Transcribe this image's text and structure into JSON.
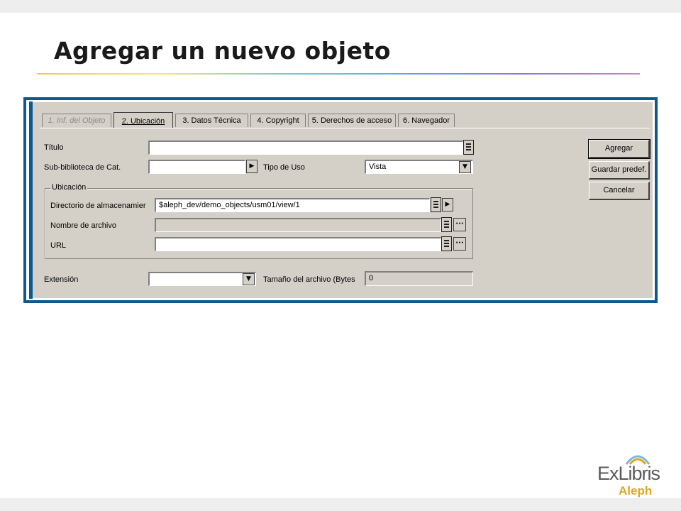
{
  "slide": {
    "title": "Agregar un nuevo objeto"
  },
  "tabs": [
    {
      "label": "1. Inf. del Objeto",
      "state": "disabled"
    },
    {
      "label": "2. Ubicación",
      "state": "active"
    },
    {
      "label": "3. Datos Técnica",
      "state": "normal"
    },
    {
      "label": "4. Copyright",
      "state": "normal"
    },
    {
      "label": "5. Derechos de acceso",
      "state": "normal"
    },
    {
      "label": "6. Navegador",
      "state": "normal"
    }
  ],
  "form": {
    "titulo_label": "Título",
    "titulo_value": "",
    "subbiblioteca_label": "Sub-biblioteca de Cat.",
    "subbiblioteca_value": "",
    "tipo_uso_label": "Tipo de Uso",
    "tipo_uso_value": "Vista",
    "ubicacion_group": "Ubicación",
    "directorio_label": "Directorio de almacenamier",
    "directorio_value": "$aleph_dev/demo_objects/usm01/view/1",
    "nombre_label": "Nombre de archivo",
    "nombre_value": "",
    "url_label": "URL",
    "url_value": "",
    "extension_label": "Extensión",
    "extension_value": "",
    "tamano_label": "Tamaño del archivo (Bytes",
    "tamano_value": "0"
  },
  "buttons": {
    "agregar": "Agregar",
    "guardar": "Guardar predef.",
    "cancelar": "Cancelar"
  },
  "logo": {
    "brand": "ExLibris",
    "product": "Aleph"
  },
  "colors": {
    "frame_blue": "#0c5a8d",
    "window_gray": "#d4d0c8",
    "logo_gold": "#e0a526"
  }
}
